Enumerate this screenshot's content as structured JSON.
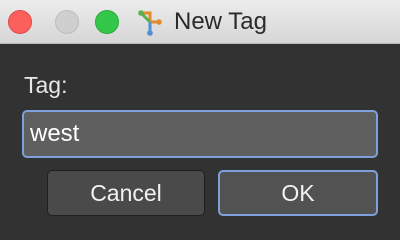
{
  "window": {
    "title": "New Tag",
    "app_icon": "git-branch-icon"
  },
  "form": {
    "label": "Tag:",
    "tag_value": "west"
  },
  "buttons": {
    "cancel_label": "Cancel",
    "ok_label": "OK"
  },
  "colors": {
    "close": "#fc605c",
    "minimize": "#cfcfcf",
    "zoom": "#34c84a",
    "focus_ring": "#7f9fd8"
  }
}
